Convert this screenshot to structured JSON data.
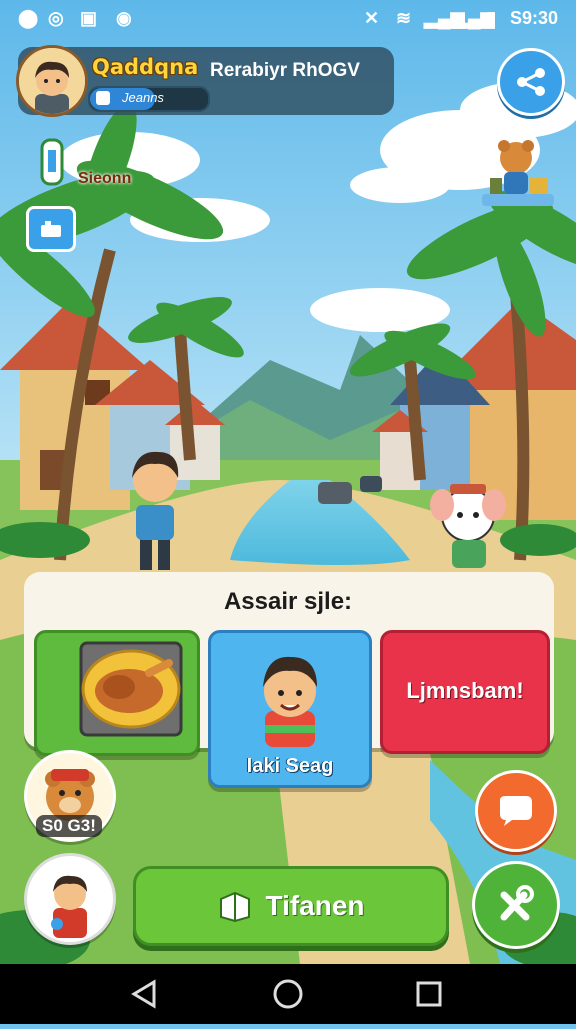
{
  "status_bar": {
    "time": "S9:30",
    "icons": [
      "location-icon",
      "at-icon",
      "gamepad-icon",
      "sync-icon",
      "mute-icon",
      "wifi-icon",
      "signal-icon",
      "signal-icon",
      "battery-icon"
    ]
  },
  "player": {
    "name": "Qaddqna",
    "title": "Rerabiyr RhOGV",
    "level_label": "Jeanns",
    "level_progress": 0.55
  },
  "season": {
    "label": "Sieonn"
  },
  "choice_panel": {
    "title": "Assair sjle:",
    "choices": [
      {
        "id": "food",
        "label": "",
        "icon": "roast-food-icon"
      },
      {
        "id": "character",
        "label": "Iaki Seag",
        "icon": "boy-avatar-icon"
      },
      {
        "id": "action",
        "label": "Ljmnsbam!",
        "icon": ""
      }
    ]
  },
  "coins": {
    "count": "S0 G3!"
  },
  "main_button": {
    "label": "Tifanen",
    "icon": "box-icon"
  },
  "colors": {
    "panel_bg": "#f8f4ea",
    "green": "#5fbb3e",
    "blue": "#4fb5ef",
    "red": "#e8334a",
    "orange": "#f26a2e",
    "gold": "#ffd53d"
  }
}
